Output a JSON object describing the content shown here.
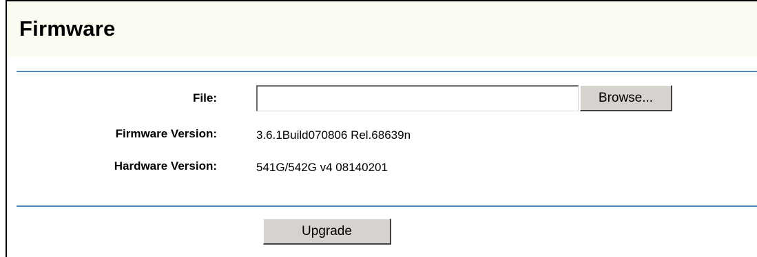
{
  "page": {
    "title": "Firmware"
  },
  "form": {
    "file_label": "File:",
    "file_value": "",
    "browse_label": "Browse...",
    "firmware_version_label": "Firmware Version:",
    "firmware_version_value": "3.6.1Build070806 Rel.68639n",
    "hardware_version_label": "Hardware Version:",
    "hardware_version_value": "541G/542G v4 08140201",
    "upgrade_label": "Upgrade"
  },
  "colors": {
    "rule": "#4e86b8",
    "title_background": "#fcfbf2",
    "button_face": "#d6d3ce"
  }
}
